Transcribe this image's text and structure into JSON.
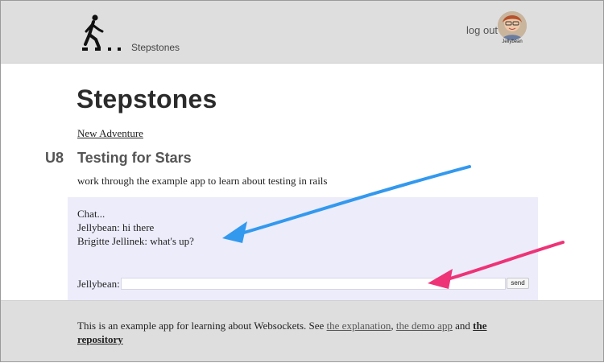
{
  "header": {
    "brand": "Stepstones",
    "logout_label": "log out",
    "user_name": "Jellybean"
  },
  "main": {
    "title": "Stepstones",
    "new_adventure_label": "New Adventure",
    "unit": {
      "code": "U8",
      "title": "Testing for Stars",
      "description": "work through the example app to learn about testing in rails"
    }
  },
  "chat": {
    "heading": "Chat...",
    "messages": [
      {
        "text": "Jellybean: hi there"
      },
      {
        "text": "Brigitte Jellinek: what's up?"
      }
    ],
    "input_label": "Jellybean:",
    "input_value": "",
    "send_label": "send"
  },
  "footer": {
    "text_before": "This is an example app for learning about Websockets. See ",
    "link_explanation": "the explanation",
    "sep1": ", ",
    "link_demo": "the demo app",
    "sep2": " and ",
    "link_repo": "the repository"
  },
  "annotations": {
    "arrow_colors": [
      "#3399ee",
      "#ee3377"
    ]
  }
}
